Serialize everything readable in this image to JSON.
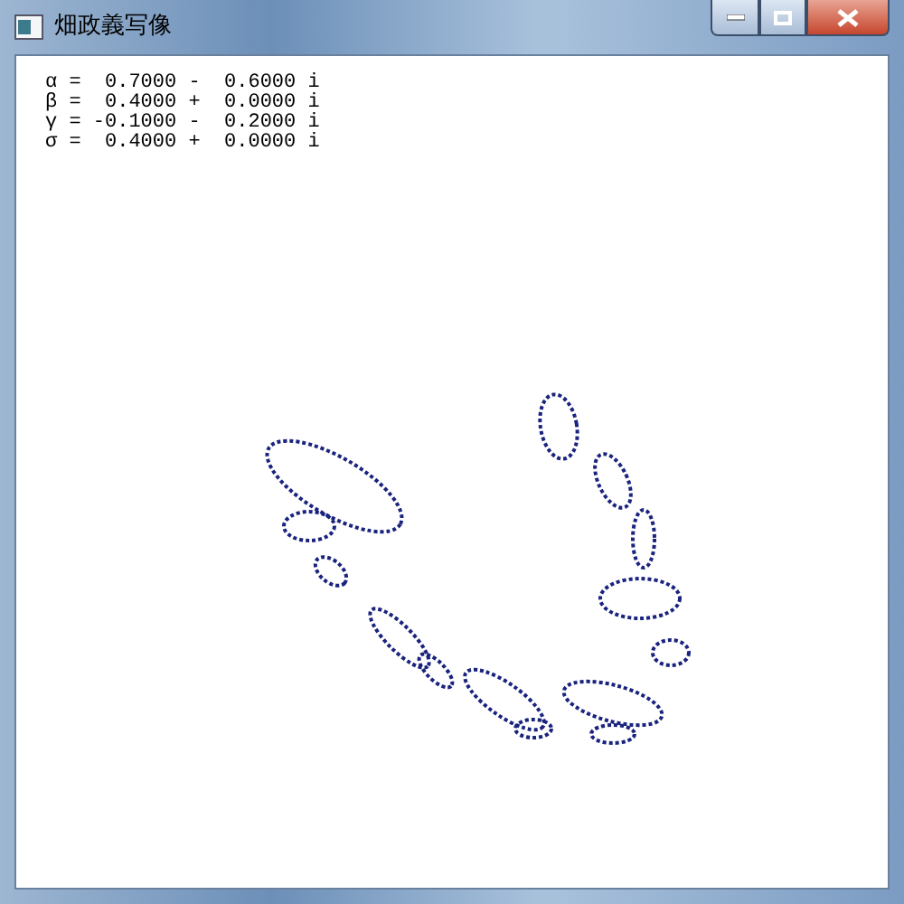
{
  "window": {
    "title": "畑政義写像"
  },
  "parameters": [
    {
      "line": "α =  0.7000 -  0.6000 i"
    },
    {
      "line": "β =  0.4000 +  0.0000 i"
    },
    {
      "line": "γ = -0.1000 -  0.2000 i"
    },
    {
      "line": "σ =  0.4000 +  0.0000 i"
    }
  ]
}
